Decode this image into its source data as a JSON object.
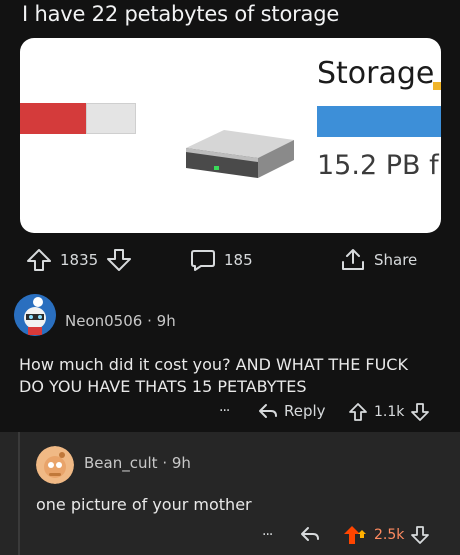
{
  "post": {
    "title": "I have 22 petabytes of storage",
    "image": {
      "storage_label": "Storage",
      "storage_value": "15.2 PB f"
    },
    "upvotes": "1835",
    "comments": "185",
    "share_label": "Share"
  },
  "comment1": {
    "username": "Neon0506",
    "separator": "·",
    "time": "9h",
    "text_line1": "How much did it cost you? AND WHAT THE FUCK",
    "text_line2": "DO YOU HAVE THATS 15 PETABYTES",
    "more": "···",
    "reply_label": "Reply",
    "score": "1.1k"
  },
  "comment2": {
    "username": "Bean_cult",
    "separator": "·",
    "time": "9h",
    "text": "one picture of your mother",
    "more": "···",
    "score": "2.5k"
  },
  "colors": {
    "background": "#121212",
    "reply_background": "#262626",
    "upvote_active": "#ff4500",
    "score_active": "#ff8b60",
    "storage_bar": "#3d8fd8"
  }
}
